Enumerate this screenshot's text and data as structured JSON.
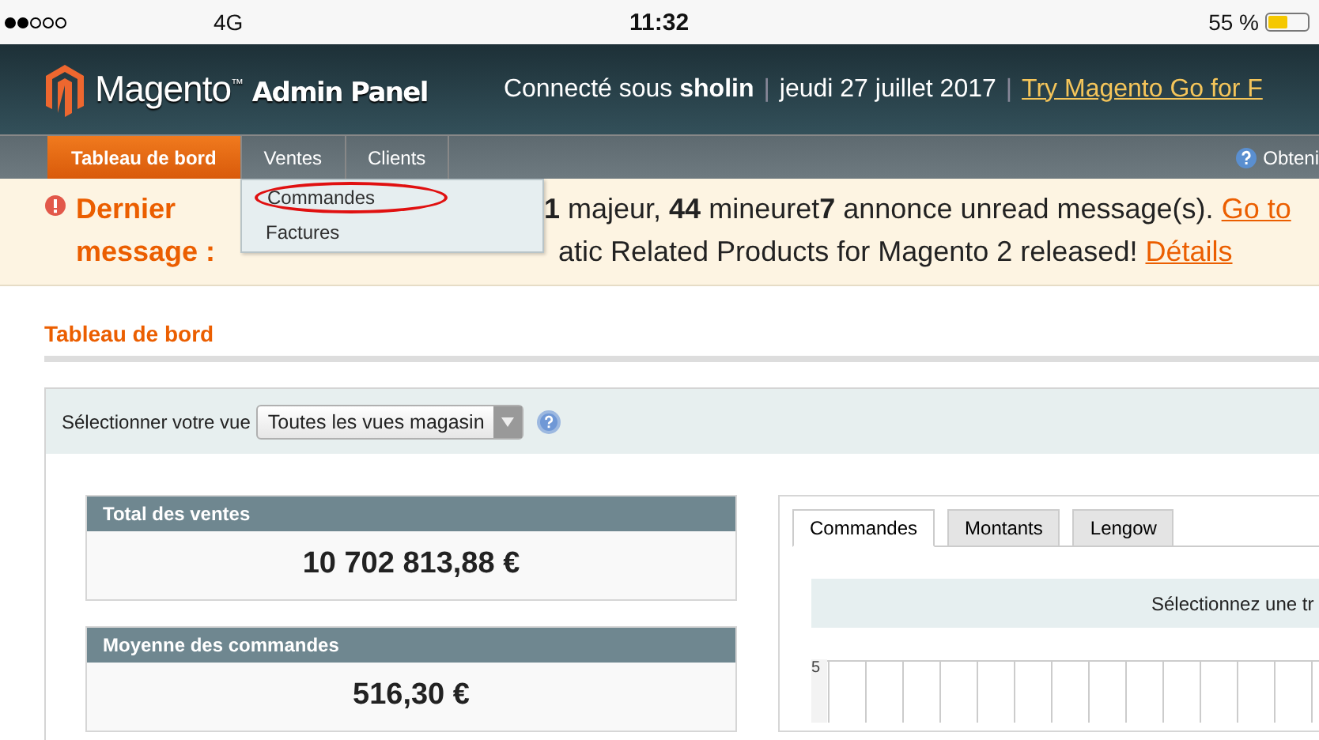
{
  "status_bar": {
    "carrier": "4G",
    "time": "11:32",
    "battery": "55 %"
  },
  "header": {
    "logo_brand": "Magento",
    "logo_tm": "™",
    "logo_product": "Admin Panel",
    "separators": [
      "|",
      "|"
    ],
    "user_prefix": "Connecté sous ",
    "user": "sholin",
    "date": "jeudi 27 juillet 2017",
    "promo_link": "Try Magento Go for F"
  },
  "nav": {
    "items": [
      {
        "label": "Tableau de bord",
        "selected": true
      },
      {
        "label": "Ventes",
        "selected": false
      },
      {
        "label": "Clients",
        "selected": false
      }
    ],
    "help": "Obteni"
  },
  "dropdown": {
    "items": [
      {
        "label": "Commandes",
        "circled": true
      },
      {
        "label": "Factures",
        "circled": false
      }
    ]
  },
  "notice": {
    "title": "Dernier message :",
    "line_1": "**1** majeur, **44** mineuret**7** annonce unread message(s).",
    "line_1_link": "Go to",
    "line_2": "atic Related Products for Magento 2 released!",
    "line_2_link": "Détails"
  },
  "page_title": "Tableau de bord",
  "store_switcher": {
    "label": "Sélectionner votre vue",
    "value": "Toutes les vues magasin"
  },
  "stats": [
    {
      "title": "Total des ventes",
      "value": "10 702 813,88 €"
    },
    {
      "title": "Moyenne des commandes",
      "value": "516,30 €"
    }
  ],
  "chart_panel": {
    "tabs": [
      {
        "label": "Commandes",
        "selected": true
      },
      {
        "label": "Montants",
        "selected": false
      },
      {
        "label": "Lengow",
        "selected": false
      }
    ],
    "notice": "Sélectionnez une tr",
    "y_tick": "5"
  }
}
